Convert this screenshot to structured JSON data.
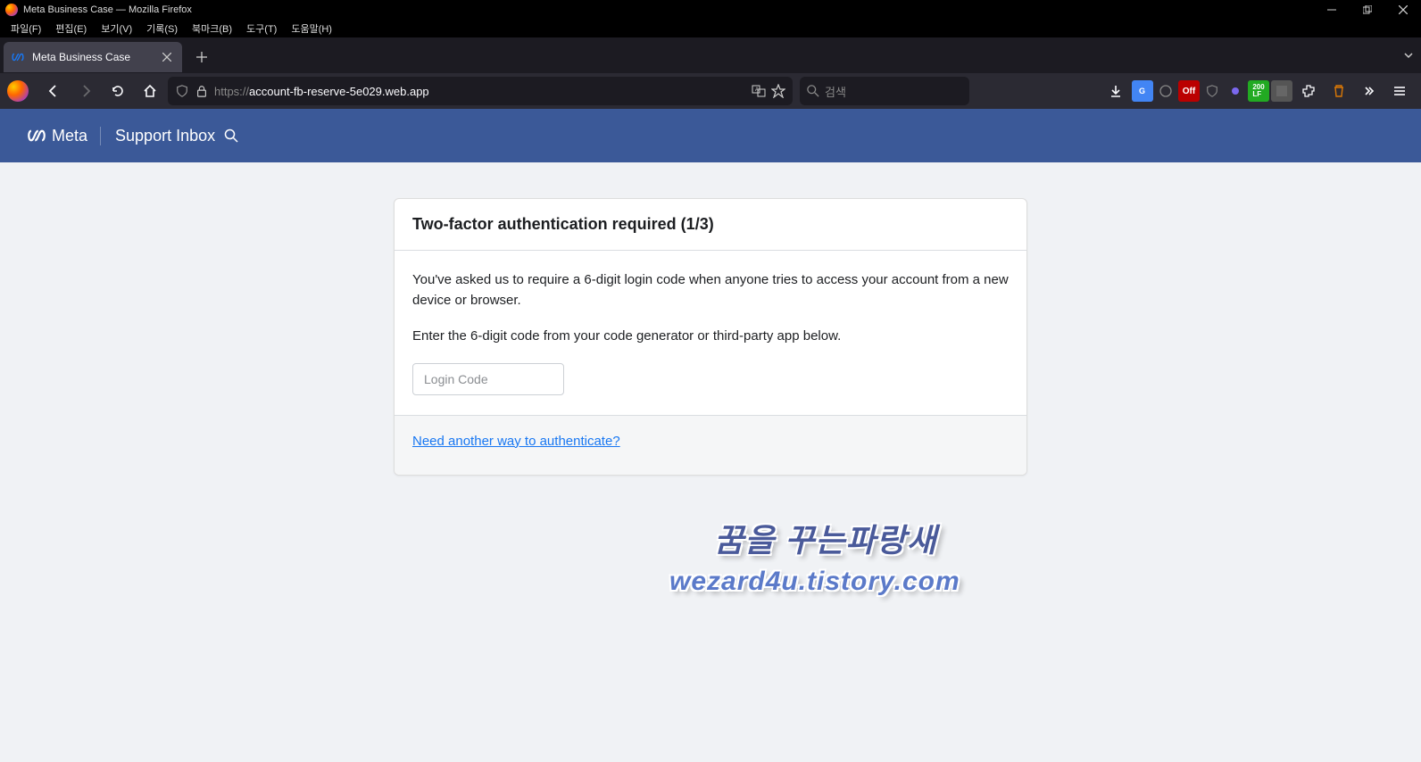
{
  "window": {
    "title": "Meta Business Case — Mozilla Firefox"
  },
  "menubar": {
    "items": [
      "파일(F)",
      "편집(E)",
      "보기(V)",
      "기록(S)",
      "북마크(B)",
      "도구(T)",
      "도움말(H)"
    ]
  },
  "tab": {
    "title": "Meta Business Case"
  },
  "urlbar": {
    "prefix": "https://",
    "domain": "account-fb-reserve-5e029.web.app"
  },
  "searchbar": {
    "placeholder": "검색"
  },
  "metaHeader": {
    "brand": "Meta",
    "title": "Support Inbox"
  },
  "card": {
    "title": "Two-factor authentication required (1/3)",
    "para1": "You've asked us to require a 6-digit login code when anyone tries to access your account from a new device or browser.",
    "para2": "Enter the 6-digit code from your code generator or third-party app below.",
    "inputPlaceholder": "Login Code",
    "footerLink": "Need another way to authenticate?"
  },
  "watermark": {
    "line1": "꿈을 꾸는파랑새",
    "line2": "wezard4u.tistory.com"
  }
}
